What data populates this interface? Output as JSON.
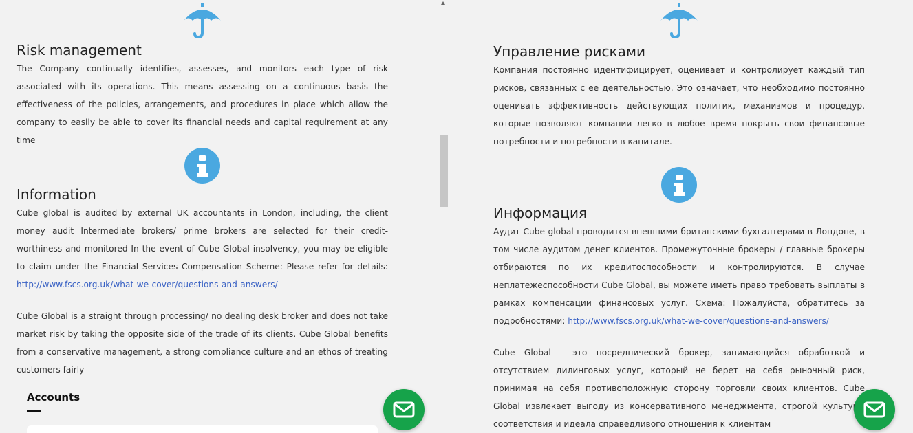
{
  "left": {
    "risk": {
      "icon": "umbrella-icon",
      "heading": "Risk management",
      "text": "The Company continually identifies, assesses, and monitors each type of risk associated with its operations. This means assessing on a continuous basis the effectiveness of the policies, arrangements, and procedures in place which allow the company to easily be able to cover its financial needs and capital requirement at any time"
    },
    "info": {
      "icon": "info-icon",
      "heading": "Information",
      "text": "Cube global is audited by external UK accountants in London, including, the client money audit Intermediate brokers/ prime brokers are selected for their credit-worthiness and monitored In the event of Cube Global insolvency, you may be eligible to claim under the Financial Services Compensation Scheme: Please refer for details:",
      "link": "http://www.fscs.org.uk/what-we-cover/questions-and-answers/",
      "text2": "Cube Global is a straight through processing/ no dealing desk broker and does not take market risk by taking the opposite side of the trade of its clients. Cube Global benefits from a conservative management, a strong compliance culture and an ethos of treating customers fairly"
    },
    "accounts": {
      "title": "Accounts"
    }
  },
  "right": {
    "risk": {
      "icon": "umbrella-icon",
      "heading": "Управление рисками",
      "text": "Компания постоянно идентифицирует, оценивает и контролирует каждый тип рисков, связанных с ее деятельностью. Это означает, что необходимо постоянно оценивать эффективность действующих политик, механизмов и процедур, которые позволяют компании легко в любое время покрыть свои финансовые потребности и потребности в капитале."
    },
    "info": {
      "icon": "info-icon",
      "heading": "Информация",
      "text": "Аудит Cube global проводится внешними британскими бухгалтерами в Лондоне, в том числе аудитом денег клиентов. Промежуточные брокеры / главные брокеры отбираются по их кредитоспособности и контролируются. В случае неплатежеспособности Cube Global, вы можете иметь право требовать выплаты в рамках компенсации финансовых услуг. Схема: Пожалуйста, обратитесь за подробностями:",
      "link": "http://www.fscs.org.uk/what-we-cover/questions-and-answers/",
      "text2": "Cube Global - это посреднический брокер, занимающийся обработкой и отсутствием дилинговых услуг, который не берет на себя рыночный риск, принимая на себя противоположную сторону торговли своих клиентов. Cube Global извлекает выгоду из консервативного менеджмента, строгой культуры соответствия и идеала справедливого отношения к клиентам"
    }
  },
  "colors": {
    "icon_blue": "#4aa8e0",
    "link_blue": "#3a62c4",
    "mail_green": "#16a34a",
    "background": "#f2f2f2"
  }
}
